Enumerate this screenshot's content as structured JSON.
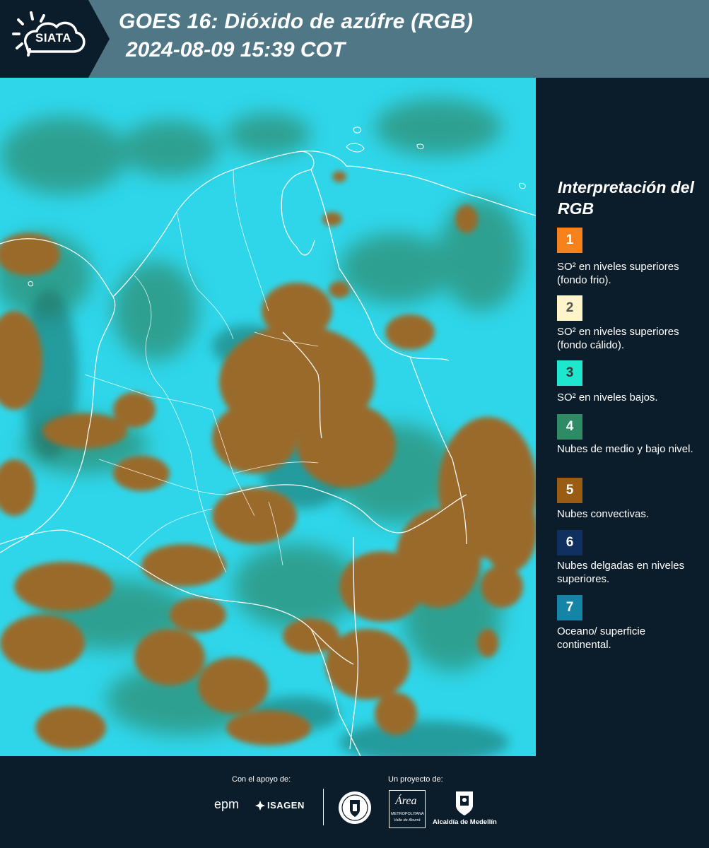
{
  "header": {
    "logo_text": "SIATA",
    "title_line1": "GOES 16: Dióxido de azúfre (RGB)",
    "title_line2": " 2024-08-09 15:39 COT",
    "colors": {
      "background": "#4f7786",
      "logo_panel": "#0b1c2a",
      "title": "#ffffff"
    }
  },
  "map": {
    "icons": [
      "satellite-image",
      "country-borders",
      "department-borders"
    ],
    "colors": {
      "background_surface": "#2fd6ea",
      "convective_clouds": "#9a6a2a",
      "low_mid_clouds": "#2e8a6a",
      "borders": "#ffffff"
    }
  },
  "legend": {
    "title": "Interpretación del RGB",
    "items": [
      {
        "number": "1",
        "color": "#f7821b",
        "number_color": "#ffffff",
        "text": "SO² en niveles superiores (fondo frio)."
      },
      {
        "number": "2",
        "color": "#fdf5c9",
        "number_color": "#555555",
        "text": "SO² en niveles superiores (fondo cálido)."
      },
      {
        "number": "3",
        "color": "#1ee6cf",
        "number_color": "#333333",
        "text": "SO² en niveles bajos."
      },
      {
        "number": "4",
        "color": "#2f8a66",
        "number_color": "#ffffff",
        "text": "Nubes de medio y bajo nivel."
      },
      {
        "number": "5",
        "color": "#9a5b12",
        "number_color": "#ffffff",
        "text": "Nubes convectivas."
      },
      {
        "number": "6",
        "color": "#0f3060",
        "number_color": "#ffffff",
        "text": "Nubes delgadas en niveles superiores."
      },
      {
        "number": "7",
        "color": "#1684a6",
        "number_color": "#ffffff",
        "text": "Oceano/ superficie continental."
      }
    ]
  },
  "footer": {
    "support_label": "Con el apoyo de:",
    "project_label": "Un proyecto de:",
    "logos": {
      "epm": "epm",
      "isagen": "ISAGEN",
      "medellin_seal": "MEDELLÍN",
      "area_name": "Área",
      "area_sub1": "METROPOLITANA",
      "area_sub2": "Valle de Aburrá",
      "alcaldia": "Alcaldía de Medellín"
    }
  }
}
